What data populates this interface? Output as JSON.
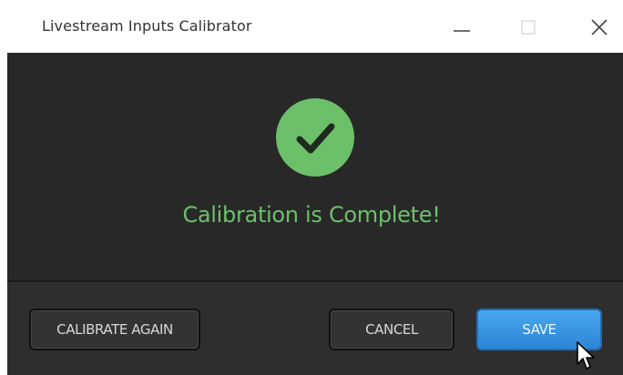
{
  "window": {
    "title": "Livestream Inputs Calibrator",
    "controls": {
      "minimize_icon": "minimize-icon",
      "maximize_icon": "maximize-icon",
      "close_icon": "close-icon"
    }
  },
  "main": {
    "status_icon": "checkmark-circle-icon",
    "status_text": "Calibration is Complete!",
    "colors": {
      "success": "#6cc06a",
      "background": "#282828"
    }
  },
  "footer": {
    "calibrate_again_label": "CALIBRATE AGAIN",
    "cancel_label": "CANCEL",
    "save_label": "SAVE",
    "colors": {
      "primary_button": "#2c86d6"
    }
  }
}
